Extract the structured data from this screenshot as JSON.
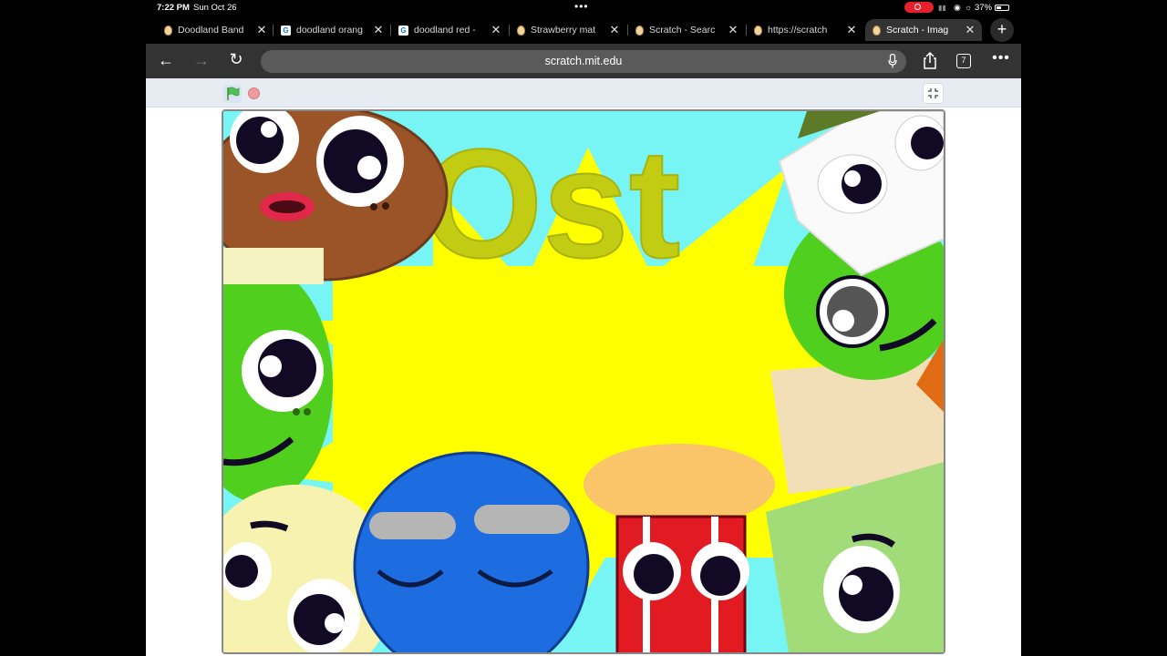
{
  "status_bar": {
    "time": "7:22 PM",
    "date": "Sun Oct 26",
    "battery": "37%"
  },
  "tabs": [
    {
      "label": "Doodland Band",
      "favicon": "scratch-favicon"
    },
    {
      "label": "doodland orang",
      "favicon": "google-favicon"
    },
    {
      "label": "doodland red -",
      "favicon": "google-favicon"
    },
    {
      "label": "Strawberry mat",
      "favicon": "scratch-favicon"
    },
    {
      "label": "Scratch - Searc",
      "favicon": "scratch-favicon"
    },
    {
      "label": "https://scratch",
      "favicon": "scratch-favicon"
    },
    {
      "label": "Scratch - Imag",
      "favicon": "scratch-favicon",
      "active": true
    }
  ],
  "toolbar": {
    "url": "scratch.mit.edu",
    "tab_count": "7"
  },
  "stage": {
    "title": "Ost"
  },
  "colors": {
    "accent_recording": "#e8202e",
    "stage_background": "#ffff00",
    "title_color": "#c7cf1a"
  }
}
